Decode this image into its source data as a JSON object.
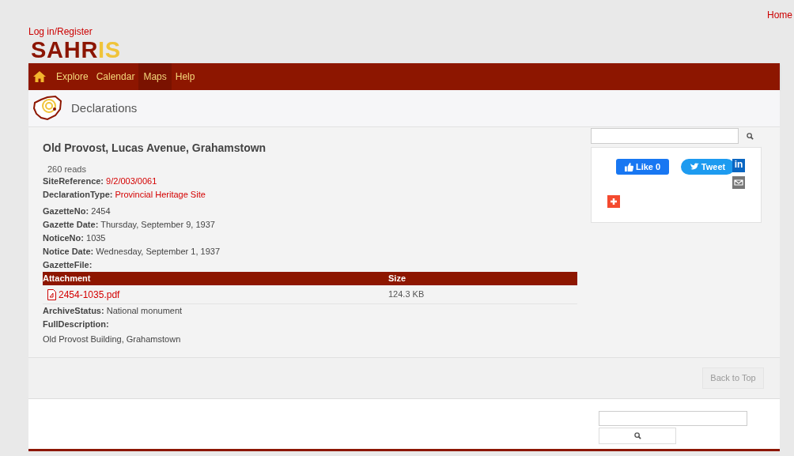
{
  "top_link": "Home",
  "login": "Log in/Register",
  "logo": {
    "main": "SAHR",
    "accent": "IS"
  },
  "nav": [
    {
      "label": "Explore",
      "selected": false
    },
    {
      "label": "Calendar",
      "selected": false
    },
    {
      "label": "Maps",
      "selected": true
    },
    {
      "label": "Help",
      "selected": false
    }
  ],
  "section_title": "Declarations",
  "article": {
    "title": "Old Provost, Lucas Avenue, Grahamstown",
    "reads": "260 reads",
    "fields": [
      {
        "label": "SiteReference:",
        "value": "9/2/003/0061",
        "kind": "link"
      },
      {
        "label": "DeclarationType:",
        "value": "Provincial Heritage Site",
        "kind": "link"
      },
      {
        "label": "GazetteNo:",
        "value": "2454",
        "kind": "text"
      },
      {
        "label": "Gazette Date:",
        "value": "Thursday, September 9, 1937",
        "kind": "text"
      },
      {
        "label": "NoticeNo:",
        "value": "1035",
        "kind": "text"
      },
      {
        "label": "Notice Date:",
        "value": "Wednesday, September 1, 1937",
        "kind": "text"
      },
      {
        "label": "GazetteFile:"
      }
    ],
    "attachments": {
      "columns": [
        "Attachment",
        "Size"
      ],
      "rows": [
        {
          "file": "2454-1035.pdf",
          "size": "124.3 KB"
        }
      ]
    },
    "after_fields": [
      {
        "label": "ArchiveStatus:",
        "value": "National monument"
      },
      {
        "label": "FullDescription:"
      }
    ],
    "description": "Old Provost Building, Grahamstown"
  },
  "share": {
    "like": "Like",
    "like_count": "0",
    "tweet": "Tweet",
    "linkedin": "in"
  },
  "back_to_top": "Back to Top"
}
